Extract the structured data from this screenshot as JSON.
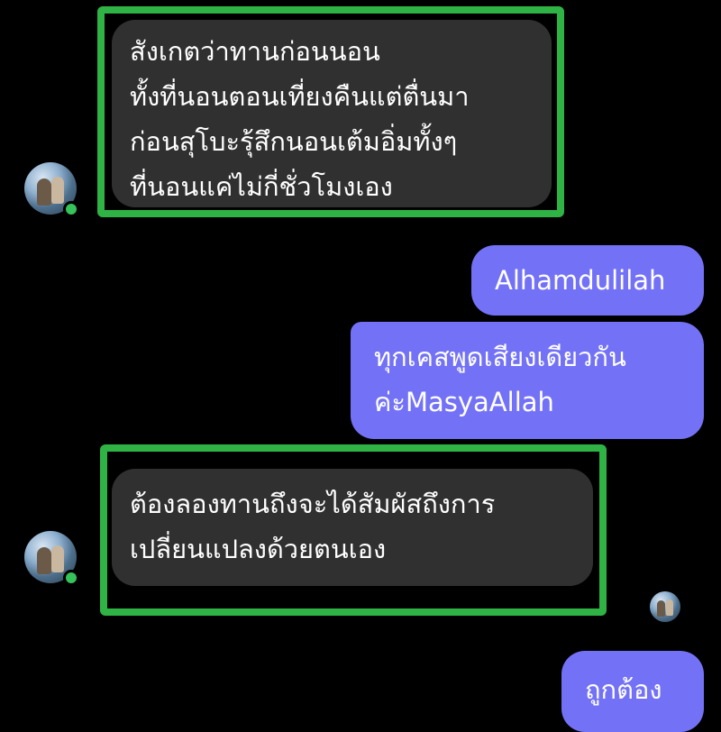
{
  "messages": [
    {
      "direction": "incoming",
      "lines": [
        "สังเกตว่าทานก่อนนอน",
        "ทั้งที่นอนตอนเที่ยงคืนแต่ตื่นมา",
        "ก่อนสุโบะรุ้สึกนอนเต้มอิ่มทั้งๆ",
        "ที่นอนแค่ไม่กี่ชั่วโมงเอง"
      ]
    },
    {
      "direction": "outgoing",
      "lines": [
        "Alhamdulilah"
      ]
    },
    {
      "direction": "outgoing",
      "lines": [
        "ทุกเคสพูดเสียงเดียวกัน",
        "ค่ะMasyaAllah"
      ]
    },
    {
      "direction": "incoming",
      "lines": [
        "ต้องลองทานถึงจะได้สัมผัสถึงการ",
        "เปลี่ยนแปลงด้วยตนเอง"
      ]
    },
    {
      "direction": "outgoing",
      "lines": [
        "ถูกต้อง"
      ]
    }
  ],
  "colors": {
    "background": "#000000",
    "incoming_bubble": "#303030",
    "outgoing_bubble": "#7372f7",
    "highlight_border": "#2fb344",
    "online_indicator": "#35c35a"
  },
  "icons": {
    "sender_avatar": "avatar-photo",
    "presence": "online-dot",
    "read_receipt": "seen-avatar"
  }
}
